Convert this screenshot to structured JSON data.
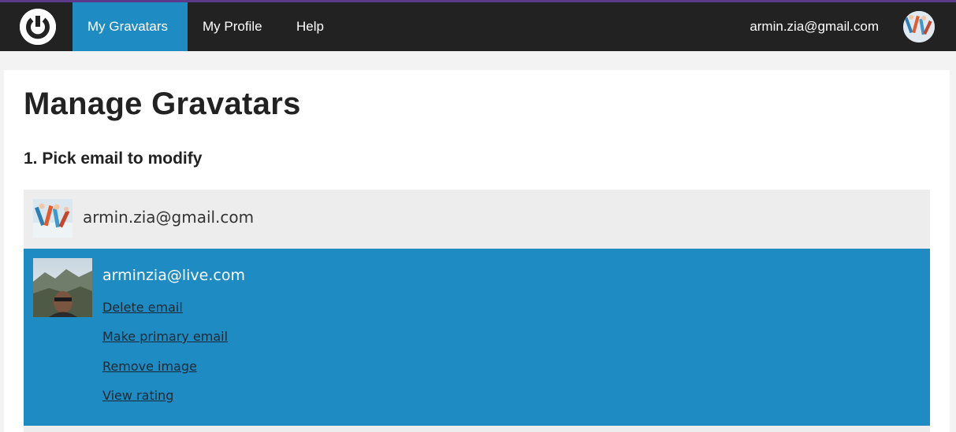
{
  "navbar": {
    "logo_icon": "gravatar-logo-icon",
    "items": [
      {
        "label": "My Gravatars",
        "active": true
      },
      {
        "label": "My Profile",
        "active": false
      },
      {
        "label": "Help",
        "active": false
      }
    ],
    "user_email": "armin.zia@gmail.com",
    "avatar_icon": "user-avatar"
  },
  "main": {
    "title": "Manage Gravatars",
    "section_title": "1. Pick email to modify",
    "emails": [
      {
        "address": "armin.zia@gmail.com",
        "selected": false,
        "thumbnail": "skiers-photo"
      },
      {
        "address": "arminzia@live.com",
        "selected": true,
        "thumbnail": "selfie-mountains-photo",
        "actions": [
          "Delete email",
          "Make primary email",
          "Remove image",
          "View rating"
        ]
      }
    ]
  },
  "colors": {
    "navbar_bg": "#222222",
    "accent_blue": "#1e8bc3",
    "top_line": "#5b3a8c",
    "row_bg": "#ededed",
    "page_bg": "#f3f3f3"
  }
}
